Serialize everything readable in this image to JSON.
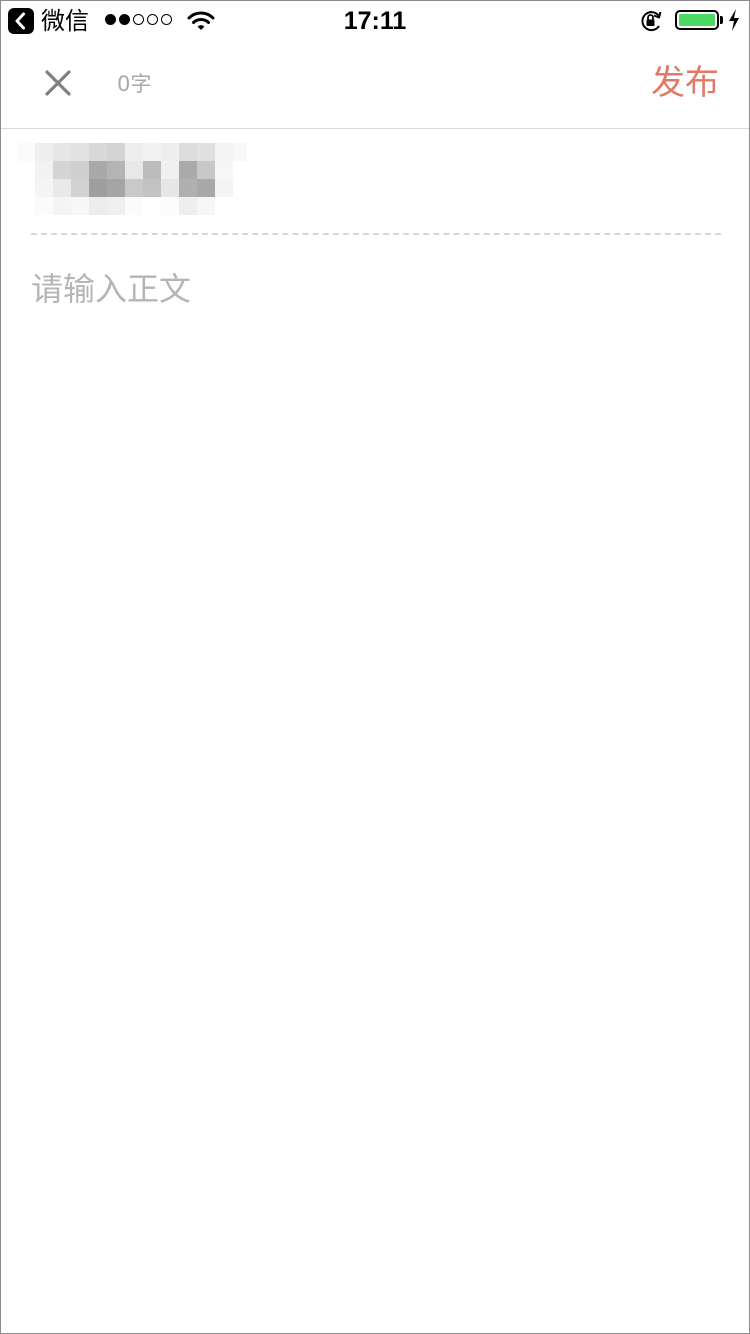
{
  "status_bar": {
    "app_name": "微信",
    "time": "17:11",
    "signal_filled": 2,
    "signal_total": 5,
    "battery_level": 1.0,
    "back_icon": "back-chevron-icon",
    "wifi_icon": "wifi-icon",
    "lock_icon": "rotation-lock-icon",
    "charging_icon": "charging-bolt-icon"
  },
  "nav": {
    "close_icon": "close-icon",
    "word_count": "0字",
    "publish_label": "发布"
  },
  "editor": {
    "title_value": "",
    "body_placeholder": "请输入正文",
    "body_value": ""
  },
  "colors": {
    "accent": "#e07a66",
    "muted_text": "#a8a8a8",
    "placeholder": "#b5b5b5",
    "divider": "#d6d6d6",
    "battery": "#4cd964"
  }
}
